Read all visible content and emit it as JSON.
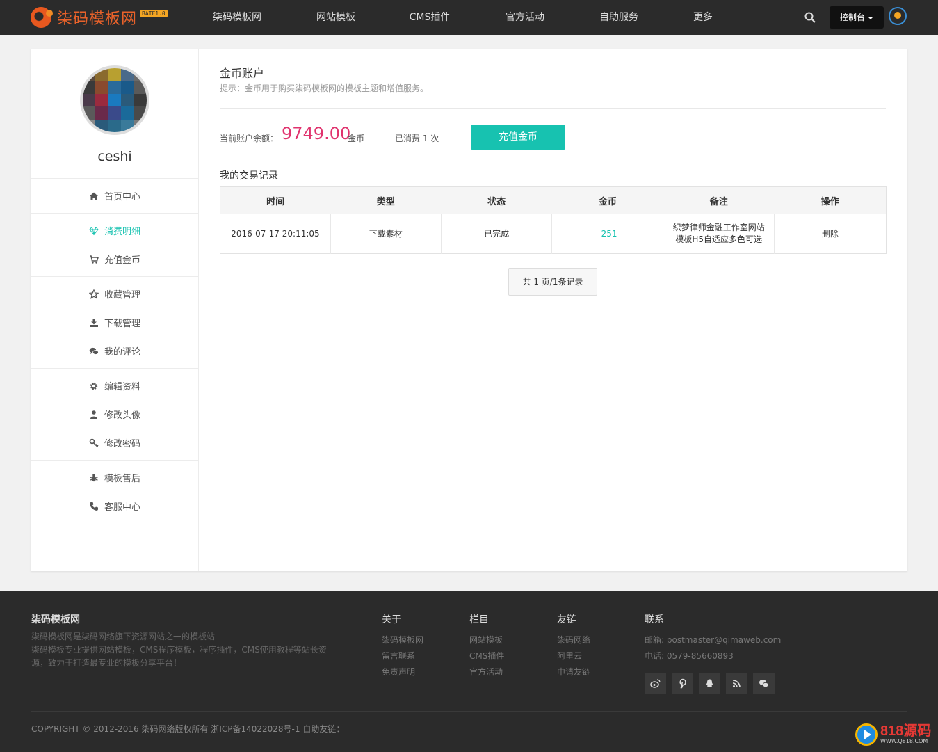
{
  "header": {
    "logo_text": "柒码模板网",
    "logo_badge": "BATE1.0",
    "nav": [
      "柒码模板网",
      "网站模板",
      "CMS插件",
      "官方活动",
      "自助服务",
      "更多"
    ],
    "console_label": "控制台"
  },
  "sidebar": {
    "username": "ceshi",
    "groups": [
      [
        {
          "label": "首页中心",
          "icon": "home-icon"
        }
      ],
      [
        {
          "label": "消费明细",
          "icon": "diamond-icon",
          "active": true
        },
        {
          "label": "充值金币",
          "icon": "cart-icon"
        }
      ],
      [
        {
          "label": "收藏管理",
          "icon": "star-icon"
        },
        {
          "label": "下载管理",
          "icon": "download-icon"
        },
        {
          "label": "我的评论",
          "icon": "comments-icon"
        }
      ],
      [
        {
          "label": "编辑资料",
          "icon": "gear-icon"
        },
        {
          "label": "修改头像",
          "icon": "user-icon"
        },
        {
          "label": "修改密码",
          "icon": "key-icon"
        }
      ],
      [
        {
          "label": "模板售后",
          "icon": "bug-icon"
        },
        {
          "label": "客服中心",
          "icon": "phone-icon"
        }
      ]
    ]
  },
  "account": {
    "title": "金币账户",
    "tip": "提示：金币用于购买柒码模板网的模板主题和增值服务。",
    "balance_label": "当前账户余额：",
    "balance_value": "9749.00",
    "balance_unit": "金币",
    "consumed": "已消费 1 次",
    "recharge_label": "充值金币"
  },
  "records": {
    "title": "我的交易记录",
    "columns": [
      "时间",
      "类型",
      "状态",
      "金币",
      "备注",
      "操作"
    ],
    "rows": [
      {
        "time": "2016-07-17 20:11:05",
        "type": "下载素材",
        "status": "已完成",
        "coin": "-251",
        "note_line1": "织梦律师金融工作室网站",
        "note_line2": "模板H5自适应多色可选",
        "action": "删除"
      }
    ],
    "pager": "共 1 页/1条记录"
  },
  "footer": {
    "brand": "柒码模板网",
    "desc_line1": "柒码模板网是柒码网络旗下资源网站之一的模板站",
    "desc_line2": "柒码模板专业提供网站模板，CMS程序模板，程序插件，CMS使用教程等站长资",
    "desc_line3": "源，致力于打造最专业的模板分享平台！",
    "cols": [
      {
        "title": "关于",
        "items": [
          "柒码模板网",
          "留言联系",
          "免责声明"
        ]
      },
      {
        "title": "栏目",
        "items": [
          "网站模板",
          "CMS插件",
          "官方活动"
        ]
      },
      {
        "title": "友链",
        "items": [
          "柒码网络",
          "阿里云",
          "申请友链"
        ]
      }
    ],
    "contact_title": "联系",
    "email": "邮箱: postmaster@qimaweb.com",
    "phone": "电话: 0579-85660893",
    "copyright": "COPYRIGHT © 2012-2016 柒码网络版权所有 浙ICP备14022028号-1 自助友链：",
    "watermark_main": "818源码",
    "watermark_sub": "WWW.Q818.COM"
  }
}
